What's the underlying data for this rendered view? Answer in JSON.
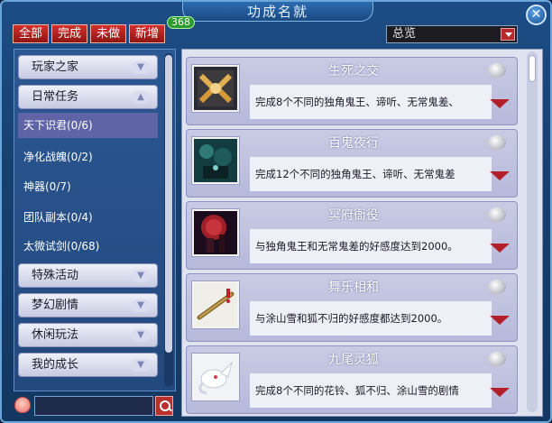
{
  "window": {
    "title": "功成名就"
  },
  "filters": [
    {
      "label": "全部"
    },
    {
      "label": "完成"
    },
    {
      "label": "未做"
    },
    {
      "label": "新增"
    }
  ],
  "new_badge": "368",
  "dropdown": {
    "selected": "总览"
  },
  "sidebar": {
    "categories": [
      {
        "label": "玩家之家",
        "expanded": false
      },
      {
        "label": "日常任务",
        "expanded": true
      },
      {
        "label": "特殊活动",
        "expanded": false
      },
      {
        "label": "梦幻剧情",
        "expanded": false
      },
      {
        "label": "休闲玩法",
        "expanded": false
      },
      {
        "label": "我的成长",
        "expanded": false
      }
    ],
    "subitems": [
      {
        "label": "天下识君(0/6)",
        "active": true
      },
      {
        "label": "净化战魄(0/2)",
        "active": false
      },
      {
        "label": "神器(0/7)",
        "active": false
      },
      {
        "label": "团队副本(0/4)",
        "active": false
      },
      {
        "label": "太微试剑(0/68)",
        "active": false
      }
    ]
  },
  "search": {
    "placeholder": ""
  },
  "achievements": [
    {
      "title": "生死之交",
      "desc": "完成8个不同的独角鬼王、谛听、无常鬼差、",
      "icon": "handshake-icon"
    },
    {
      "title": "百鬼夜行",
      "desc": "完成12个不同的独角鬼王、谛听、无常鬼差",
      "icon": "night-spirits-icon"
    },
    {
      "title": "冥府衙役",
      "desc": "与独角鬼王和无常鬼差的好感度达到2000。",
      "icon": "red-moon-icon"
    },
    {
      "title": "舞乐相和",
      "desc": "与涂山雪和狐不归的好感度都达到2000。",
      "icon": "flute-icon"
    },
    {
      "title": "九尾灵狐",
      "desc": "完成8个不同的花铃、狐不归、涂山雪的剧情",
      "icon": "white-fox-icon"
    }
  ],
  "colors": {
    "window_bg": "#16406f",
    "tab_red": "#c8282a",
    "card_bg": "#c1c4e0",
    "active_item": "#5e64a6"
  }
}
